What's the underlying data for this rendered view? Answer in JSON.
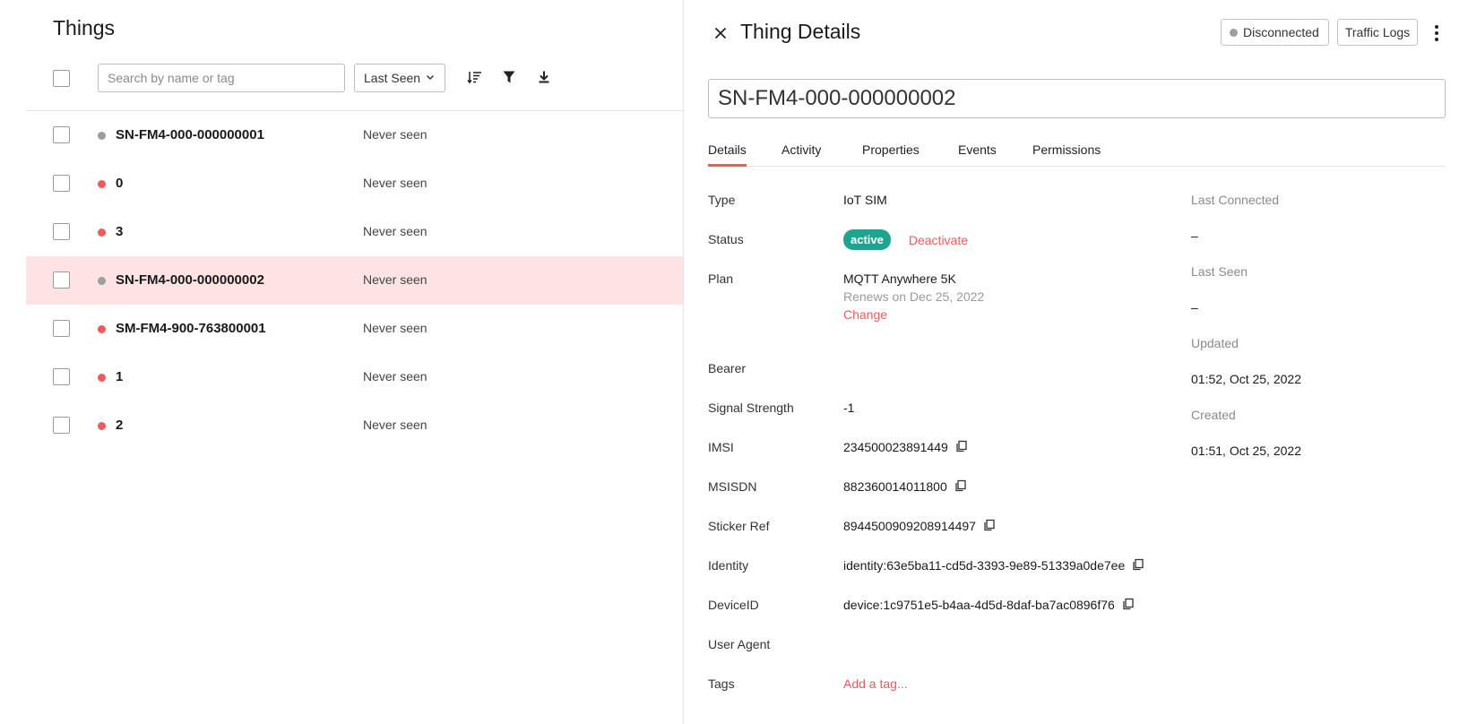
{
  "list": {
    "title": "Things",
    "search_placeholder": "Search by name or tag",
    "sort_label": "Last Seen",
    "rows": [
      {
        "name": "SN-FM4-000-000000001",
        "last_seen": "Never seen",
        "status_color": "#9e9e9e",
        "selected": false
      },
      {
        "name": "0",
        "last_seen": "Never seen",
        "status_color": "#ef5b5b",
        "selected": false
      },
      {
        "name": "3",
        "last_seen": "Never seen",
        "status_color": "#ef5b5b",
        "selected": false
      },
      {
        "name": "SN-FM4-000-000000002",
        "last_seen": "Never seen",
        "status_color": "#9e9e9e",
        "selected": true
      },
      {
        "name": "SM-FM4-900-763800001",
        "last_seen": "Never seen",
        "status_color": "#ef5b5b",
        "selected": false
      },
      {
        "name": "1",
        "last_seen": "Never seen",
        "status_color": "#ef5b5b",
        "selected": false
      },
      {
        "name": "2",
        "last_seen": "Never seen",
        "status_color": "#ef5b5b",
        "selected": false
      }
    ]
  },
  "detail": {
    "title": "Thing Details",
    "connection_status": "Disconnected",
    "traffic_logs_label": "Traffic Logs",
    "name_value": "SN-FM4-000-000000002",
    "tabs": [
      "Details",
      "Activity",
      "Properties",
      "Events",
      "Permissions"
    ],
    "active_tab": "Details",
    "fields": {
      "type_label": "Type",
      "type_value": "IoT SIM",
      "status_label": "Status",
      "status_value": "active",
      "deactivate_label": "Deactivate",
      "plan_label": "Plan",
      "plan_value": "MQTT Anywhere 5K",
      "plan_renews": "Renews on Dec 25, 2022",
      "plan_change": "Change",
      "bearer_label": "Bearer",
      "signal_label": "Signal Strength",
      "signal_value": "-1",
      "imsi_label": "IMSI",
      "imsi_value": "234500023891449",
      "msisdn_label": "MSISDN",
      "msisdn_value": "882360014011800",
      "sticker_label": "Sticker Ref",
      "sticker_value": "8944500909208914497",
      "identity_label": "Identity",
      "identity_value": "identity:63e5ba11-cd5d-3393-9e89-51339a0de7ee",
      "deviceid_label": "DeviceID",
      "deviceid_value": "device:1c9751e5-b4aa-4d5d-8daf-ba7ac0896f76",
      "useragent_label": "User Agent",
      "tags_label": "Tags",
      "add_tag_label": "Add a tag..."
    },
    "side": {
      "last_connected_label": "Last Connected",
      "last_connected_value": "–",
      "last_seen_label": "Last Seen",
      "last_seen_value": "–",
      "updated_label": "Updated",
      "updated_value": "01:52, Oct 25, 2022",
      "created_label": "Created",
      "created_value": "01:51, Oct 25, 2022"
    }
  },
  "colors": {
    "accent": "#ef5b5b",
    "active_badge": "#1fa58f",
    "selected_row": "#fde3e3"
  },
  "icons": [
    "sort-icon",
    "filter-icon",
    "download-icon",
    "close-icon",
    "more-vertical-icon",
    "copy-icon",
    "chevron-down-icon"
  ]
}
